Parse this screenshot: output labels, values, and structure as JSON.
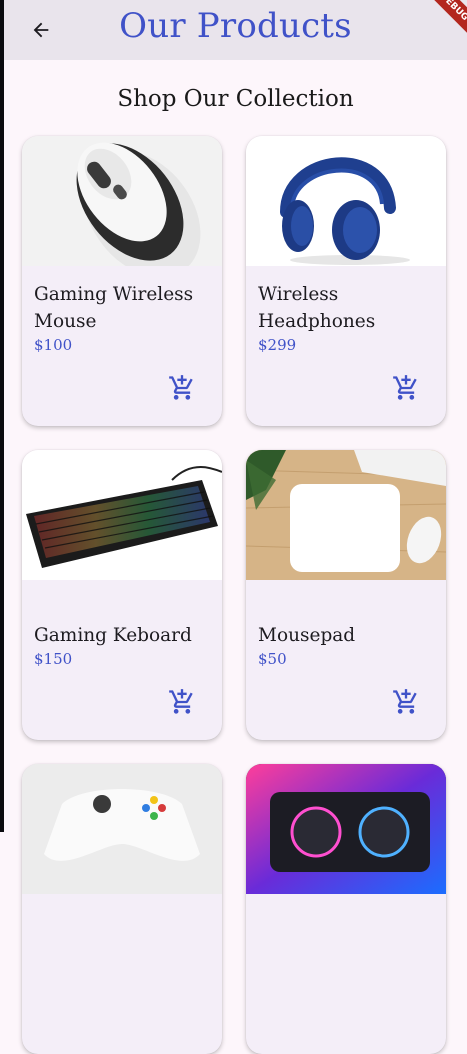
{
  "app": {
    "title": "Our Products",
    "debug_banner": "DEBUG",
    "accent_color": "#4052c8"
  },
  "section_title": "Shop Our Collection",
  "products": [
    {
      "name": "Gaming Wireless Mouse",
      "price": "$100",
      "image": "mouse-image",
      "action_icon": "add-shopping-cart-icon"
    },
    {
      "name": "Wireless Headphones",
      "price": "$299",
      "image": "headphones-image",
      "action_icon": "add-shopping-cart-icon"
    },
    {
      "name": "Gaming Keboard",
      "price": "$150",
      "image": "keyboard-image",
      "action_icon": "add-shopping-cart-icon"
    },
    {
      "name": "Mousepad",
      "price": "$50",
      "image": "mousepad-image",
      "action_icon": "add-shopping-cart-icon"
    },
    {
      "name": "",
      "price": "",
      "image": "controller-image"
    },
    {
      "name": "",
      "price": "",
      "image": "graphics-card-image"
    }
  ]
}
